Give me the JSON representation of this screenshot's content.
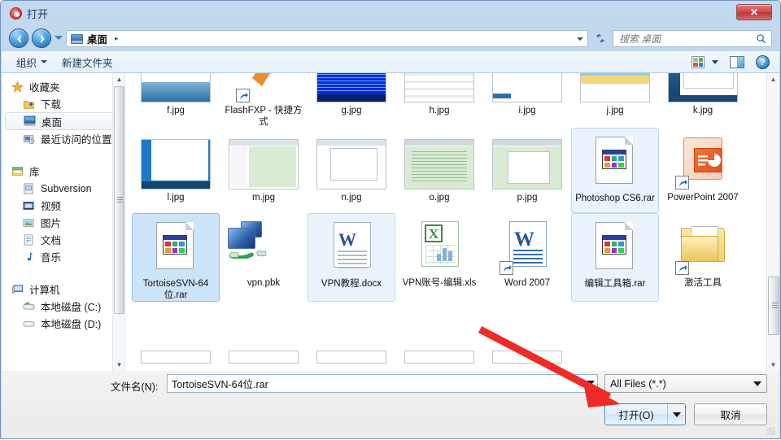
{
  "window": {
    "title": "打开",
    "title_icon": "app-circle-icon",
    "close_label": "✕"
  },
  "nav": {
    "back_icon": "back-arrow-icon",
    "forward_icon": "forward-arrow-icon",
    "history_icon": "history-dropdown-icon",
    "address_value": "桌面",
    "address_separator": "▸",
    "refresh_icon": "refresh-icon",
    "search_placeholder": "搜索 桌面",
    "search_icon": "search-icon"
  },
  "commandbar": {
    "organize_label": "组织",
    "new_folder_label": "新建文件夹",
    "view_icon": "view-mode-icon",
    "preview_pane_icon": "preview-pane-icon",
    "help_icon": "help-icon",
    "help_glyph": "?"
  },
  "sidebar": {
    "groups": [
      {
        "header": {
          "label": "收藏夹",
          "icon": "star-icon"
        },
        "items": [
          {
            "label": "下载",
            "icon": "downloads-icon",
            "selected": false
          },
          {
            "label": "桌面",
            "icon": "desktop-icon",
            "selected": true
          },
          {
            "label": "最近访问的位置",
            "icon": "recent-places-icon",
            "selected": false
          }
        ]
      },
      {
        "header": {
          "label": "库",
          "icon": "library-icon"
        },
        "items": [
          {
            "label": "Subversion",
            "icon": "subversion-icon",
            "selected": false
          },
          {
            "label": "视频",
            "icon": "video-icon",
            "selected": false
          },
          {
            "label": "图片",
            "icon": "pictures-icon",
            "selected": false
          },
          {
            "label": "文档",
            "icon": "documents-icon",
            "selected": false
          },
          {
            "label": "音乐",
            "icon": "music-icon",
            "selected": false
          }
        ]
      },
      {
        "header": {
          "label": "计算机",
          "icon": "computer-icon"
        },
        "items": [
          {
            "label": "本地磁盘 (C:)",
            "icon": "system-drive-icon",
            "selected": false
          },
          {
            "label": "本地磁盘 (D:)",
            "icon": "drive-icon",
            "selected": false
          }
        ]
      }
    ]
  },
  "files": {
    "rows": [
      [
        {
          "name": "f.jpg",
          "kind": "image",
          "state": "none"
        },
        {
          "name": "FlashFXP - 快捷方式",
          "kind": "shortcut-app",
          "state": "none"
        },
        {
          "name": "g.jpg",
          "kind": "image-blue",
          "state": "none"
        },
        {
          "name": "h.jpg",
          "kind": "image",
          "state": "none"
        },
        {
          "name": "i.jpg",
          "kind": "image",
          "state": "none"
        },
        {
          "name": "j.jpg",
          "kind": "image",
          "state": "none"
        },
        {
          "name": "k.jpg",
          "kind": "image-blue",
          "state": "none"
        }
      ],
      [
        {
          "name": "l.jpg",
          "kind": "image-blue",
          "state": "none"
        },
        {
          "name": "m.jpg",
          "kind": "image",
          "state": "none"
        },
        {
          "name": "n.jpg",
          "kind": "image",
          "state": "none"
        },
        {
          "name": "o.jpg",
          "kind": "image",
          "state": "none"
        },
        {
          "name": "p.jpg",
          "kind": "image",
          "state": "none"
        },
        {
          "name": "Photoshop CS6.rar",
          "kind": "rar",
          "state": "hover"
        },
        {
          "name": "PowerPoint 2007",
          "kind": "powerpoint-shortcut",
          "state": "none"
        }
      ],
      [
        {
          "name": "TortoiseSVN-64位.rar",
          "kind": "rar",
          "state": "selected"
        },
        {
          "name": "vpn.pbk",
          "kind": "dialup",
          "state": "none"
        },
        {
          "name": "VPN教程.docx",
          "kind": "word",
          "state": "hover"
        },
        {
          "name": "VPN账号-编辑.xls",
          "kind": "excel",
          "state": "none"
        },
        {
          "name": "Word 2007",
          "kind": "word-shortcut",
          "state": "none"
        },
        {
          "name": "编辑工具箱.rar",
          "kind": "rar",
          "state": "hover"
        },
        {
          "name": "激活工具",
          "kind": "folder-shortcut",
          "state": "none"
        }
      ]
    ]
  },
  "bottom": {
    "filename_label": "文件名(N):",
    "filename_value": "TortoiseSVN-64位.rar",
    "filter_value": "All Files (*.*)",
    "open_label": "打开(O)",
    "cancel_label": "取消"
  },
  "annotation": {
    "arrow_color": "#ee2b26",
    "points_to": "打开(O)"
  }
}
